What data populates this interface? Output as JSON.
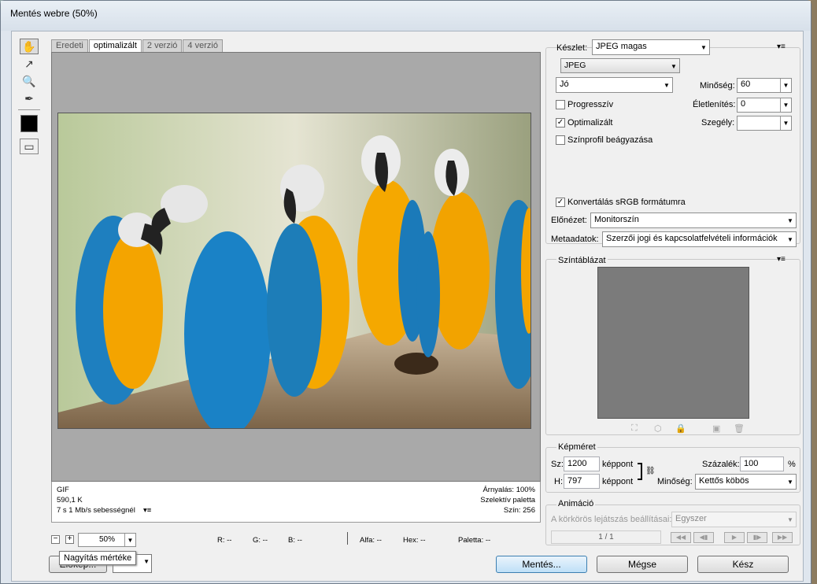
{
  "window": {
    "title": "Mentés webre (50%)"
  },
  "tabs": [
    "Eredeti",
    "optimalizált",
    "2 verzió",
    "4 verzió"
  ],
  "info": {
    "format": "GIF",
    "size": "590,1 K",
    "speed": "7 s 1 Mb/s sebességnél",
    "dither": "Árnyalás: 100%",
    "palette": "Szelektív paletta",
    "colors": "Szín: 256"
  },
  "zoom": {
    "value": "50%",
    "tooltip": "Nagyítás mértéke"
  },
  "readout": {
    "r": "R: --",
    "g": "G: --",
    "b": "B: --",
    "alpha": "Alfa: --",
    "hex": "Hex: --",
    "palette": "Paletta: --"
  },
  "settings": {
    "preset_label": "Készlet:",
    "preset_value": "JPEG magas",
    "format": "JPEG",
    "quality_preset": "Jó",
    "quality_label": "Minőség:",
    "quality_value": "60",
    "progressive": "Progresszív",
    "sharpen_label": "Életlenítés:",
    "sharpen_value": "0",
    "optimized": "Optimalizált",
    "matte_label": "Szegély:",
    "matte_value": "",
    "embed_profile": "Színprofil beágyazása",
    "convert_srgb": "Konvertálás sRGB formátumra",
    "preview_label": "Előnézet:",
    "preview_value": "Monitorszín",
    "meta_label": "Metaadatok:",
    "meta_value": "Szerzői jogi és kapcsolatfelvételi információk"
  },
  "colortable": {
    "title": "Színtáblázat"
  },
  "imagesize": {
    "title": "Képméret",
    "w_label": "Sz:",
    "w_value": "1200",
    "w_unit": "képpont",
    "h_label": "H:",
    "h_value": "797",
    "h_unit": "képpont",
    "pct_label": "Százalék:",
    "pct_value": "100",
    "pct_unit": "%",
    "quality_label": "Minőség:",
    "quality_value": "Kettős köbös"
  },
  "animation": {
    "title": "Animáció",
    "loop_label": "A körkörös lejátszás beállításai:",
    "loop_value": "Egyszer",
    "frame": "1 / 1"
  },
  "buttons": {
    "preview": "Előkép...",
    "save": "Mentés...",
    "cancel": "Mégse",
    "done": "Kész"
  }
}
